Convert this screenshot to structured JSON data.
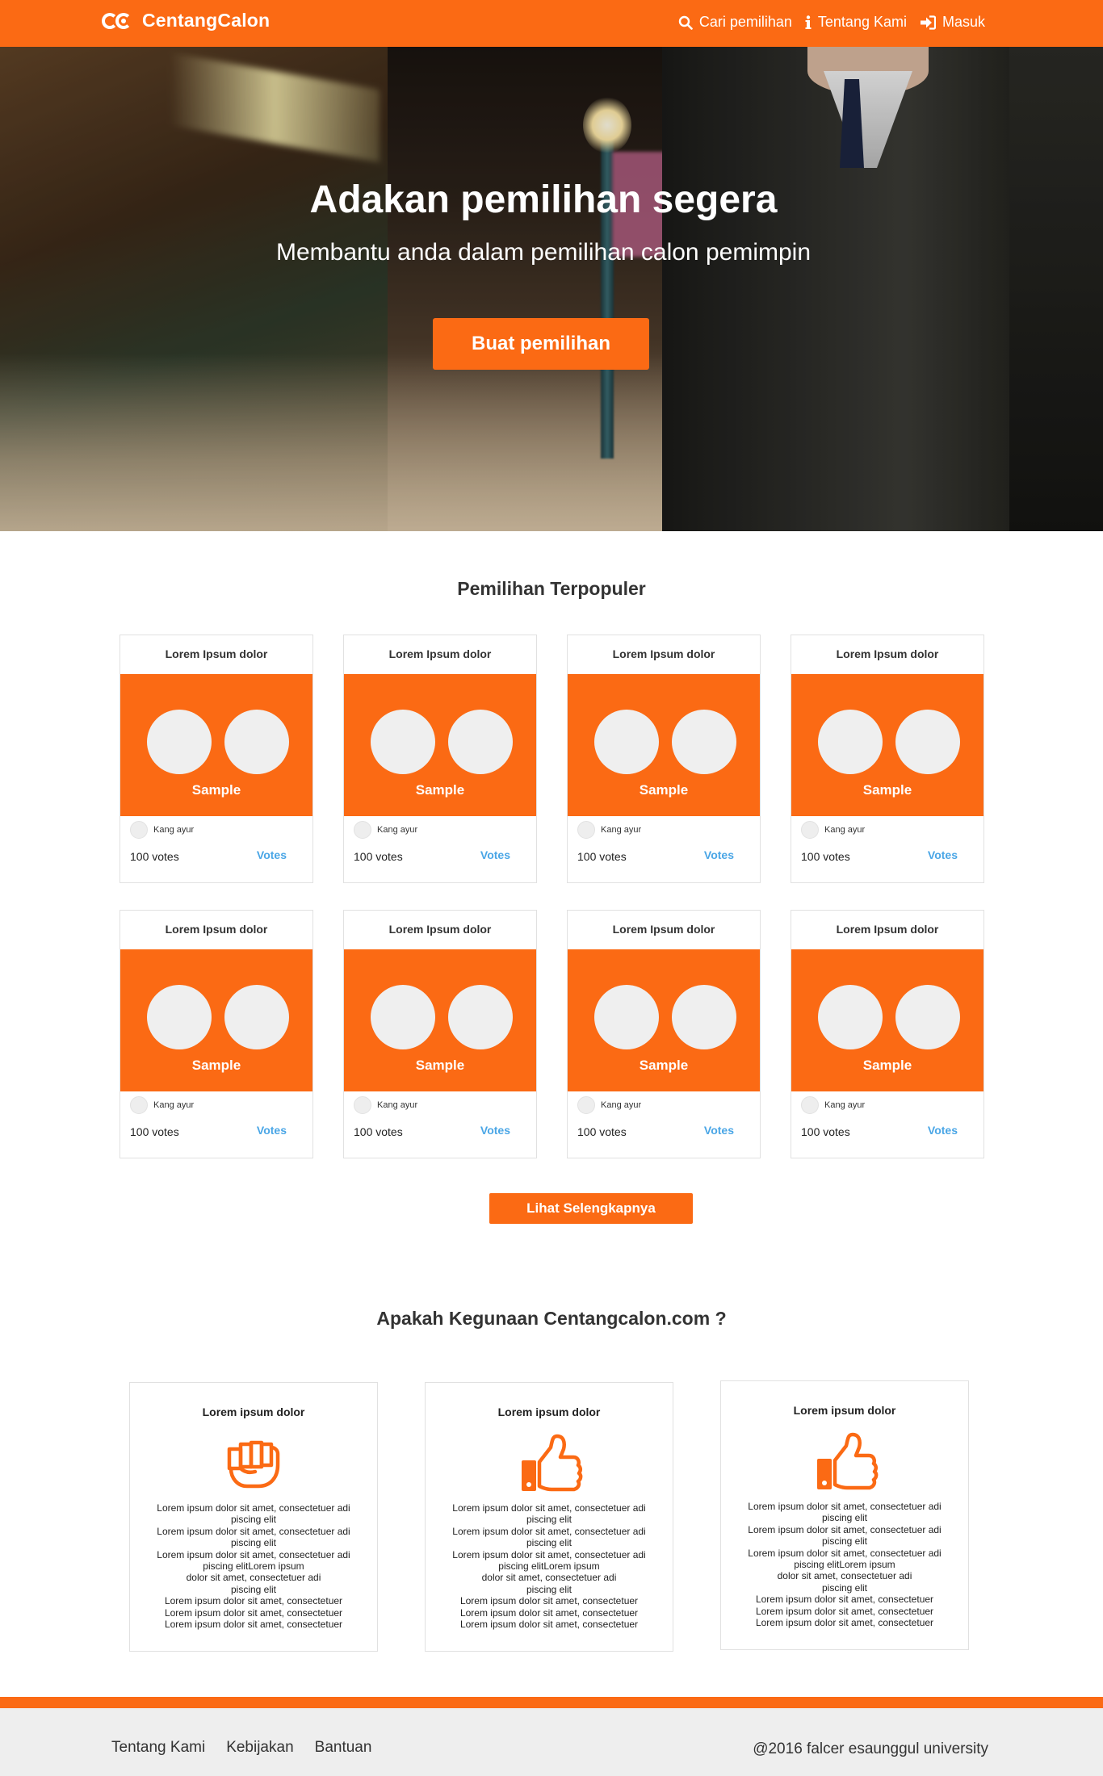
{
  "colors": {
    "accent": "#fb6a14",
    "vote_link": "#4aa6e6",
    "footer_bg": "#eeeeee"
  },
  "nav": {
    "brand": "CentangCalon",
    "links": [
      {
        "label": "Cari pemilihan",
        "icon": "search-icon"
      },
      {
        "label": "Tentang Kami",
        "icon": "info-icon"
      },
      {
        "label": "Masuk",
        "icon": "sign-in-icon"
      }
    ]
  },
  "hero": {
    "title": "Adakan pemilihan segera",
    "subtitle": "Membantu anda dalam pemilihan calon pemimpin",
    "button": "Buat pemilihan"
  },
  "popular": {
    "heading": "Pemilihan Terpopuler",
    "polls": [
      {
        "title": "Lorem Ipsum dolor",
        "sample": "Sample",
        "author": "Kang ayur",
        "count": "100 votes",
        "vote": "Votes"
      },
      {
        "title": "Lorem Ipsum dolor",
        "sample": "Sample",
        "author": "Kang ayur",
        "count": "100 votes",
        "vote": "Votes"
      },
      {
        "title": "Lorem Ipsum dolor",
        "sample": "Sample",
        "author": "Kang ayur",
        "count": "100 votes",
        "vote": "Votes"
      },
      {
        "title": "Lorem Ipsum dolor",
        "sample": "Sample",
        "author": "Kang ayur",
        "count": "100 votes",
        "vote": "Votes"
      },
      {
        "title": "Lorem Ipsum dolor",
        "sample": "Sample",
        "author": "Kang ayur",
        "count": "100 votes",
        "vote": "Votes"
      },
      {
        "title": "Lorem Ipsum dolor",
        "sample": "Sample",
        "author": "Kang ayur",
        "count": "100 votes",
        "vote": "Votes"
      },
      {
        "title": "Lorem Ipsum dolor",
        "sample": "Sample",
        "author": "Kang ayur",
        "count": "100 votes",
        "vote": "Votes"
      },
      {
        "title": "Lorem Ipsum dolor",
        "sample": "Sample",
        "author": "Kang ayur",
        "count": "100 votes",
        "vote": "Votes"
      }
    ],
    "more_button": "Lihat Selengkapnya"
  },
  "features": {
    "heading": "Apakah Kegunaan Centangcalon.com ?",
    "cards": [
      {
        "title": "Lorem ipsum dolor",
        "icon": "fist-icon",
        "text": "Lorem ipsum dolor sit amet, consectetuer adi\npiscing elit\nLorem ipsum dolor sit amet, consectetuer adi\npiscing elit\nLorem ipsum dolor sit amet, consectetuer adi\npiscing elitLorem ipsum\ndolor sit amet, consectetuer adi\npiscing elit\nLorem ipsum dolor sit amet, consectetuer\nLorem ipsum dolor sit amet, consectetuer\nLorem ipsum dolor sit amet, consectetuer"
      },
      {
        "title": "Lorem ipsum dolor",
        "icon": "thumbs-up-icon",
        "text": "Lorem ipsum dolor sit amet, consectetuer adi\npiscing elit\nLorem ipsum dolor sit amet, consectetuer adi\npiscing elit\nLorem ipsum dolor sit amet, consectetuer adi\npiscing elitLorem ipsum\ndolor sit amet, consectetuer adi\npiscing elit\nLorem ipsum dolor sit amet, consectetuer\nLorem ipsum dolor sit amet, consectetuer\nLorem ipsum dolor sit amet, consectetuer"
      },
      {
        "title": "Lorem ipsum dolor",
        "icon": "thumbs-up-icon",
        "text": "Lorem ipsum dolor sit amet, consectetuer adi\npiscing elit\nLorem ipsum dolor sit amet, consectetuer adi\npiscing elit\nLorem ipsum dolor sit amet, consectetuer adi\npiscing elitLorem ipsum\ndolor sit amet, consectetuer adi\npiscing elit\nLorem ipsum dolor sit amet, consectetuer\nLorem ipsum dolor sit amet, consectetuer\nLorem ipsum dolor sit amet, consectetuer"
      }
    ]
  },
  "footer": {
    "links": [
      "Tentang Kami",
      "Kebijakan",
      "Bantuan"
    ],
    "copyright": "@2016 falcer esaunggul university"
  }
}
